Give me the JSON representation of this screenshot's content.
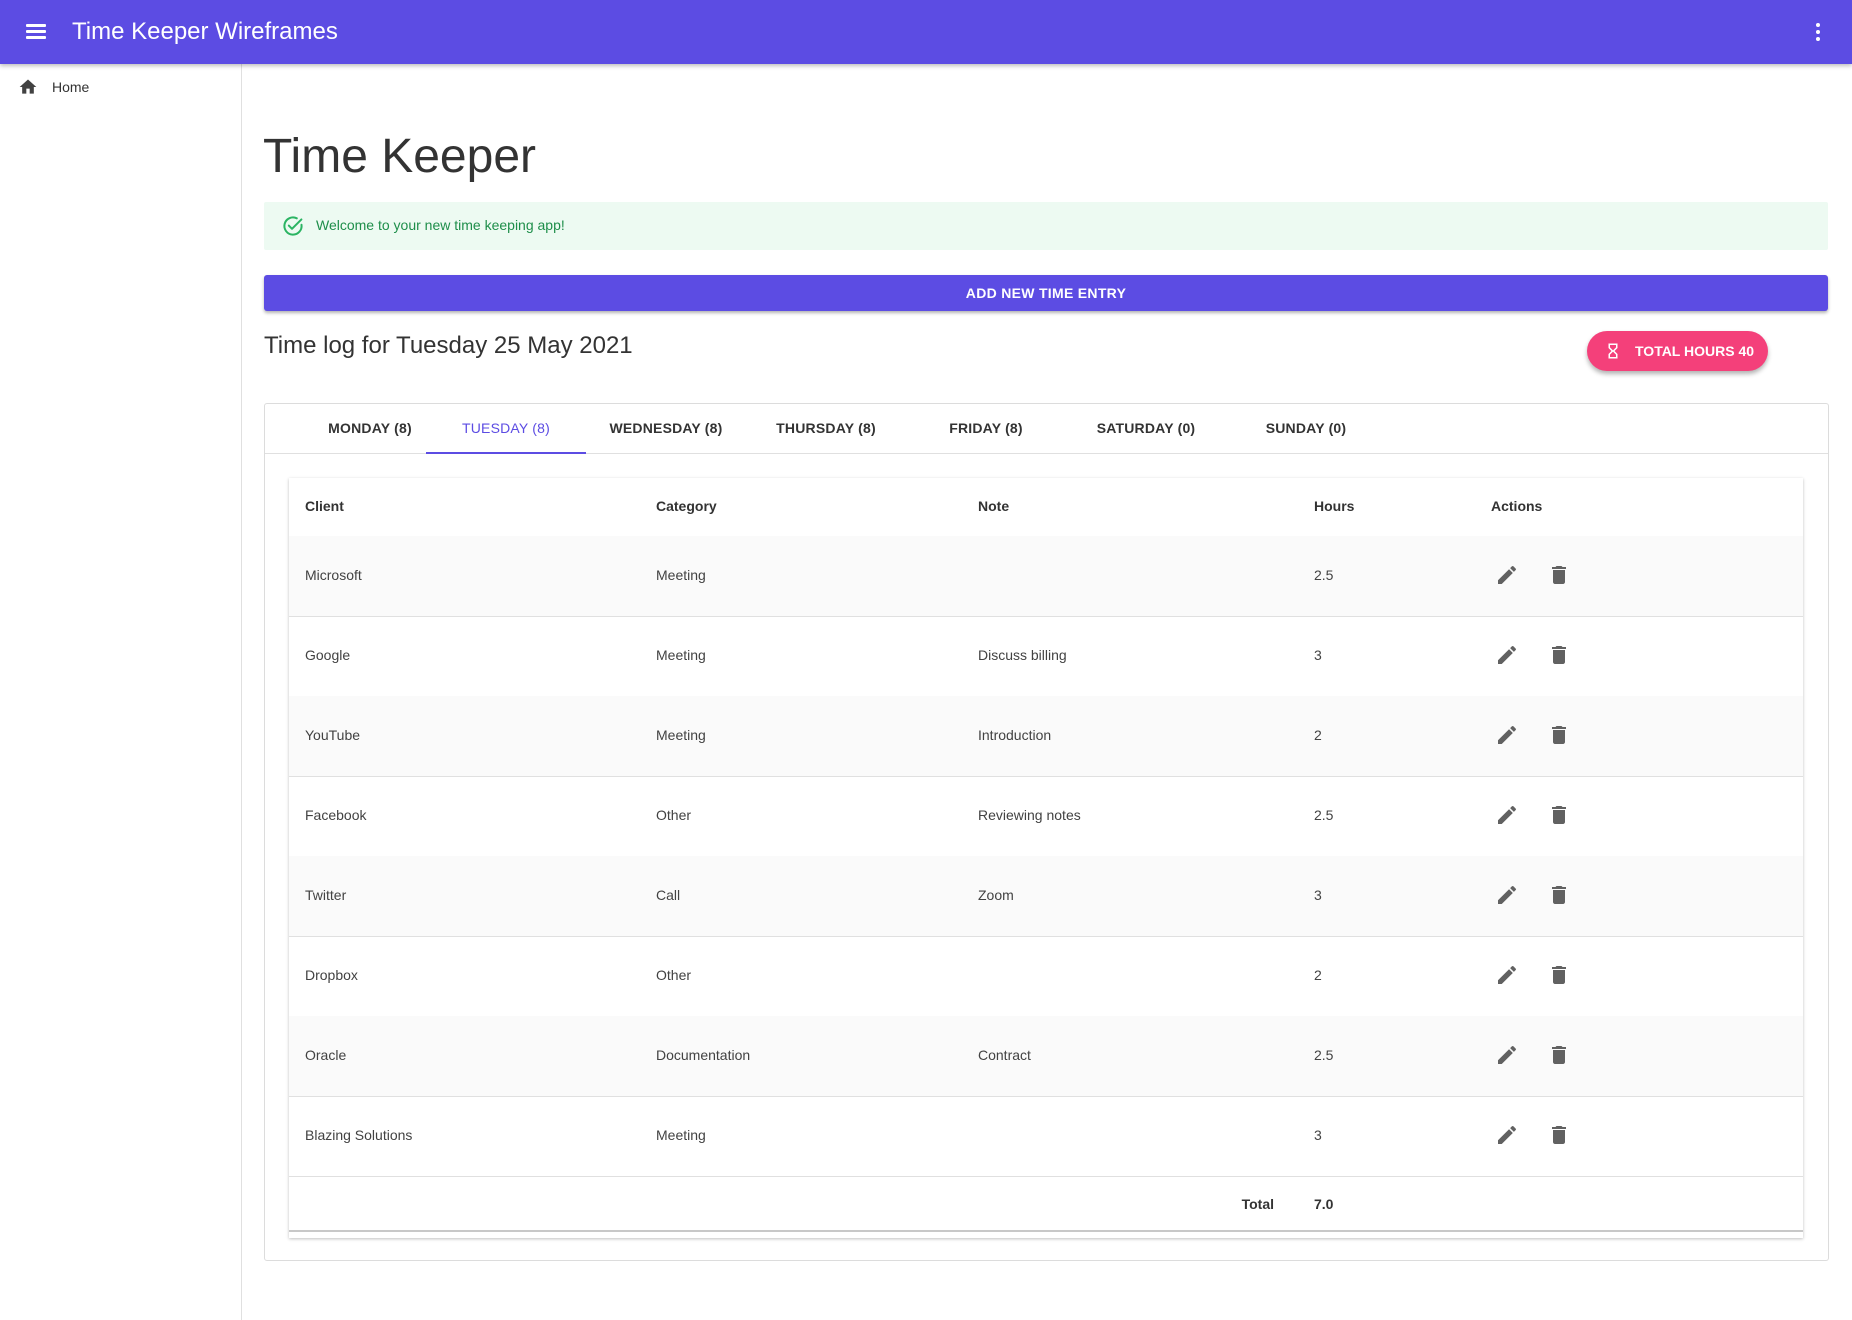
{
  "app": {
    "title": "Time Keeper Wireframes"
  },
  "sidebar": {
    "items": [
      {
        "label": "Home"
      }
    ]
  },
  "page": {
    "title": "Time Keeper"
  },
  "alert": {
    "message": "Welcome to your new time keeping app!",
    "color": "#1e8e4a"
  },
  "actions": {
    "add_entry_label": "ADD NEW TIME ENTRY"
  },
  "log": {
    "title": "Time log for Tuesday 25 May 2021"
  },
  "total_badge": {
    "label": "TOTAL HOURS 40",
    "color": "#f4407a"
  },
  "tabs": [
    {
      "label": "MONDAY (8)"
    },
    {
      "label": "TUESDAY (8)"
    },
    {
      "label": "WEDNESDAY (8)"
    },
    {
      "label": "THURSDAY (8)"
    },
    {
      "label": "FRIDAY (8)"
    },
    {
      "label": "SATURDAY (0)"
    },
    {
      "label": "SUNDAY (0)"
    }
  ],
  "active_tab": "TUESDAY (8)",
  "table": {
    "columns": {
      "client": "Client",
      "category": "Category",
      "note": "Note",
      "hours": "Hours",
      "actions": "Actions"
    },
    "rows": [
      {
        "client": "Microsoft",
        "category": "Meeting",
        "note": "",
        "hours": "2.5"
      },
      {
        "client": "Google",
        "category": "Meeting",
        "note": "Discuss billing",
        "hours": "3"
      },
      {
        "client": "YouTube",
        "category": "Meeting",
        "note": "Introduction",
        "hours": "2"
      },
      {
        "client": "Facebook",
        "category": "Other",
        "note": "Reviewing notes",
        "hours": "2.5"
      },
      {
        "client": "Twitter",
        "category": "Call",
        "note": "Zoom",
        "hours": "3"
      },
      {
        "client": "Dropbox",
        "category": "Other",
        "note": "",
        "hours": "2"
      },
      {
        "client": "Oracle",
        "category": "Documentation",
        "note": "Contract",
        "hours": "2.5"
      },
      {
        "client": "Blazing Solutions",
        "category": "Meeting",
        "note": "",
        "hours": "3"
      }
    ],
    "footer": {
      "label": "Total",
      "value": "7.0"
    }
  },
  "colors": {
    "primary": "#5c4ce3",
    "accent": "#f4407a"
  },
  "icons": {
    "menu": "menu-icon",
    "more": "more-vert-icon",
    "home": "home-icon",
    "check": "check-circle-icon",
    "hourglass": "hourglass-icon",
    "edit": "pencil-icon",
    "delete": "trash-icon"
  }
}
